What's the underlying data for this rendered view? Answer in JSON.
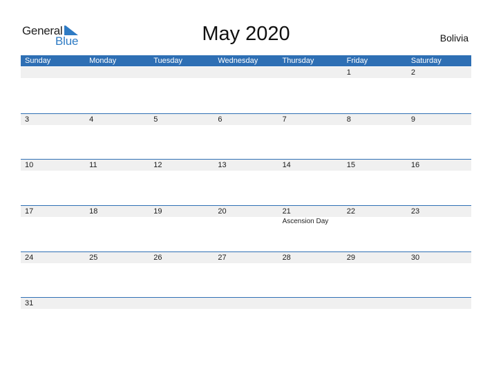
{
  "brand": {
    "word1": "General",
    "word2": "Blue",
    "accent": "#2e7bc4"
  },
  "header": {
    "title": "May 2020",
    "country": "Bolivia"
  },
  "colors": {
    "header_bg": "#2e6fb4",
    "date_band": "#f0f0f0",
    "row_border": "#2e6fb4"
  },
  "weekdays": [
    "Sunday",
    "Monday",
    "Tuesday",
    "Wednesday",
    "Thursday",
    "Friday",
    "Saturday"
  ],
  "weeks": [
    [
      {
        "d": ""
      },
      {
        "d": ""
      },
      {
        "d": ""
      },
      {
        "d": ""
      },
      {
        "d": ""
      },
      {
        "d": "1"
      },
      {
        "d": "2"
      }
    ],
    [
      {
        "d": "3"
      },
      {
        "d": "4"
      },
      {
        "d": "5"
      },
      {
        "d": "6"
      },
      {
        "d": "7"
      },
      {
        "d": "8"
      },
      {
        "d": "9"
      }
    ],
    [
      {
        "d": "10"
      },
      {
        "d": "11"
      },
      {
        "d": "12"
      },
      {
        "d": "13"
      },
      {
        "d": "14"
      },
      {
        "d": "15"
      },
      {
        "d": "16"
      }
    ],
    [
      {
        "d": "17"
      },
      {
        "d": "18"
      },
      {
        "d": "19"
      },
      {
        "d": "20"
      },
      {
        "d": "21",
        "event": "Ascension Day"
      },
      {
        "d": "22"
      },
      {
        "d": "23"
      }
    ],
    [
      {
        "d": "24"
      },
      {
        "d": "25"
      },
      {
        "d": "26"
      },
      {
        "d": "27"
      },
      {
        "d": "28"
      },
      {
        "d": "29"
      },
      {
        "d": "30"
      }
    ],
    [
      {
        "d": "31"
      },
      {
        "d": ""
      },
      {
        "d": ""
      },
      {
        "d": ""
      },
      {
        "d": ""
      },
      {
        "d": ""
      },
      {
        "d": ""
      }
    ]
  ]
}
